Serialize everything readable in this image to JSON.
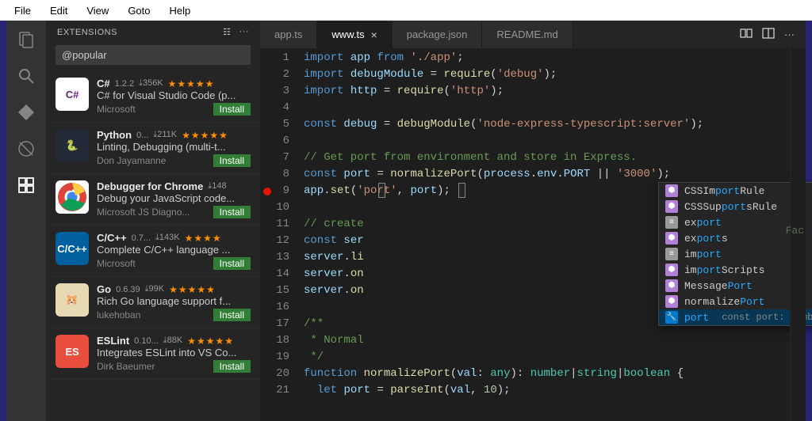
{
  "menubar": [
    "File",
    "Edit",
    "View",
    "Goto",
    "Help"
  ],
  "sidebar": {
    "title": "EXTENSIONS",
    "search": "@popular",
    "install_label": "Install",
    "items": [
      {
        "name": "C#",
        "version": "1.2.2",
        "downloads": "356K",
        "stars": "★★★★★",
        "desc": "C# for Visual Studio Code (p...",
        "publisher": "Microsoft",
        "iconBg": "#fff",
        "iconFg": "#68217a",
        "iconText": "C#"
      },
      {
        "name": "Python",
        "version": "0...",
        "downloads": "211K",
        "stars": "★★★★★",
        "desc": "Linting, Debugging (multi-t...",
        "publisher": "Don Jayamanne",
        "iconBg": "#242938",
        "iconFg": "#ffd43b",
        "iconText": "🐍"
      },
      {
        "name": "Debugger for Chrome",
        "version": "",
        "downloads": "148",
        "stars": "",
        "desc": "Debug your JavaScript code...",
        "publisher": "Microsoft JS Diagno...",
        "iconBg": "#fff",
        "iconFg": "#fff",
        "iconText": "◉"
      },
      {
        "name": "C/C++",
        "version": "0.7...",
        "downloads": "143K",
        "stars": "★★★★",
        "desc": "Complete C/C++ language ...",
        "publisher": "Microsoft",
        "iconBg": "#005f9e",
        "iconFg": "#fff",
        "iconText": "C/C++"
      },
      {
        "name": "Go",
        "version": "0.6.39",
        "downloads": "99K",
        "stars": "★★★★★",
        "desc": "Rich Go language support f...",
        "publisher": "lukehoban",
        "iconBg": "#e8d9b5",
        "iconFg": "#333",
        "iconText": "🐹"
      },
      {
        "name": "ESLint",
        "version": "0.10...",
        "downloads": "88K",
        "stars": "★★★★★",
        "desc": "Integrates ESLint into VS Co...",
        "publisher": "Dirk Baeumer",
        "iconBg": "#e84d3d",
        "iconFg": "#fff",
        "iconText": "ES"
      }
    ]
  },
  "tabs": [
    {
      "label": "app.ts",
      "active": false
    },
    {
      "label": "www.ts",
      "active": true
    },
    {
      "label": "package.json",
      "active": false
    },
    {
      "label": "README.md",
      "active": false
    }
  ],
  "code": {
    "lines": [
      {
        "n": 1,
        "html": "<span class='kw'>import</span> <span class='va'>app</span> <span class='kw'>from</span> <span class='str'>'./app'</span><span class='pl'>;</span>"
      },
      {
        "n": 2,
        "html": "<span class='kw'>import</span> <span class='va'>debugModule</span> <span class='pl'>=</span> <span class='fn'>require</span><span class='pl'>(</span><span class='str'>'debug'</span><span class='pl'>);</span>"
      },
      {
        "n": 3,
        "html": "<span class='kw'>import</span> <span class='va'>http</span> <span class='pl'>=</span> <span class='fn'>require</span><span class='pl'>(</span><span class='str'>'http'</span><span class='pl'>);</span>"
      },
      {
        "n": 4,
        "html": ""
      },
      {
        "n": 5,
        "html": "<span class='kw'>const</span> <span class='va'>debug</span> <span class='pl'>=</span> <span class='fn'>debugModule</span><span class='pl'>(</span><span class='str'>'node-express-typescript:server'</span><span class='pl'>);</span>"
      },
      {
        "n": 6,
        "html": ""
      },
      {
        "n": 7,
        "html": "<span class='cm'>// Get port from environment and store in Express.</span>"
      },
      {
        "n": 8,
        "html": "<span class='kw'>const</span> <span class='va'>port</span> <span class='pl'>=</span> <span class='fn'>normalizePort</span><span class='pl'>(</span><span class='va'>process</span><span class='pl'>.</span><span class='va'>env</span><span class='pl'>.</span><span class='va'>PORT</span> <span class='pl'>||</span> <span class='str'>'3000'</span><span class='pl'>);</span>"
      },
      {
        "n": 9,
        "html": "<span class='va'>app</span><span class='pl'>.</span><span class='fn'>set</span><span class='pl'>(</span><span class='str'>'port'</span><span class='pl'>,</span> <span class='va'>port</span><span class='pl'>);</span>",
        "bp": true
      },
      {
        "n": 10,
        "html": ""
      },
      {
        "n": 11,
        "html": "<span class='cm'>// create</span>"
      },
      {
        "n": 12,
        "html": "<span class='kw'>const</span> <span class='va'>ser</span>"
      },
      {
        "n": 13,
        "html": "<span class='va'>server</span><span class='pl'>.</span><span class='fn'>li</span>"
      },
      {
        "n": 14,
        "html": "<span class='va'>server</span><span class='pl'>.</span><span class='fn'>on</span>"
      },
      {
        "n": 15,
        "html": "<span class='va'>server</span><span class='pl'>.</span><span class='fn'>on</span>"
      },
      {
        "n": 16,
        "html": ""
      },
      {
        "n": 17,
        "html": "<span class='cm'>/**</span>"
      },
      {
        "n": 18,
        "html": "<span class='cm'> * Normal</span>"
      },
      {
        "n": 19,
        "html": "<span class='cm'> */</span>"
      },
      {
        "n": 20,
        "html": "<span class='kw'>function</span> <span class='fn'>normalizePort</span><span class='pl'>(</span><span class='va'>val</span><span class='pl'>:</span> <span class='ty'>any</span><span class='pl'>):</span> <span class='ty'>number</span><span class='pl'>|</span><span class='ty'>string</span><span class='pl'>|</span><span class='ty'>boolean</span> <span class='pl'>{</span>"
      },
      {
        "n": 21,
        "html": "  <span class='kw'>let</span> <span class='va'>port</span> <span class='pl'>=</span> <span class='fn'>parseInt</span><span class='pl'>(</span><span class='va'>val</span><span class='pl'>,</span> <span class='nu'>10</span><span class='pl'>);</span>"
      }
    ]
  },
  "suggest": [
    {
      "icon": "⬢",
      "iconBg": "#b180d7",
      "pre": "CSSIm",
      "match": "port",
      "post": "Rule"
    },
    {
      "icon": "⬢",
      "iconBg": "#b180d7",
      "pre": "CSSSup",
      "match": "port",
      "post": "sRule"
    },
    {
      "icon": "≡",
      "iconBg": "#999",
      "pre": "ex",
      "match": "port",
      "post": ""
    },
    {
      "icon": "⬢",
      "iconBg": "#b180d7",
      "pre": "ex",
      "match": "port",
      "post": "s"
    },
    {
      "icon": "≡",
      "iconBg": "#999",
      "pre": "im",
      "match": "port",
      "post": ""
    },
    {
      "icon": "⬢",
      "iconBg": "#b180d7",
      "pre": "im",
      "match": "port",
      "post": "Scripts"
    },
    {
      "icon": "⬢",
      "iconBg": "#b180d7",
      "pre": "Message",
      "match": "Port",
      "post": ""
    },
    {
      "icon": "⬢",
      "iconBg": "#b180d7",
      "pre": "normalize",
      "match": "Port",
      "post": ""
    },
    {
      "icon": "🔧",
      "iconBg": "#007acc",
      "pre": "",
      "match": "port",
      "post": "",
      "hint": "const port: number | string | boolean",
      "selected": true
    }
  ],
  "factory_truncated": "Fac"
}
